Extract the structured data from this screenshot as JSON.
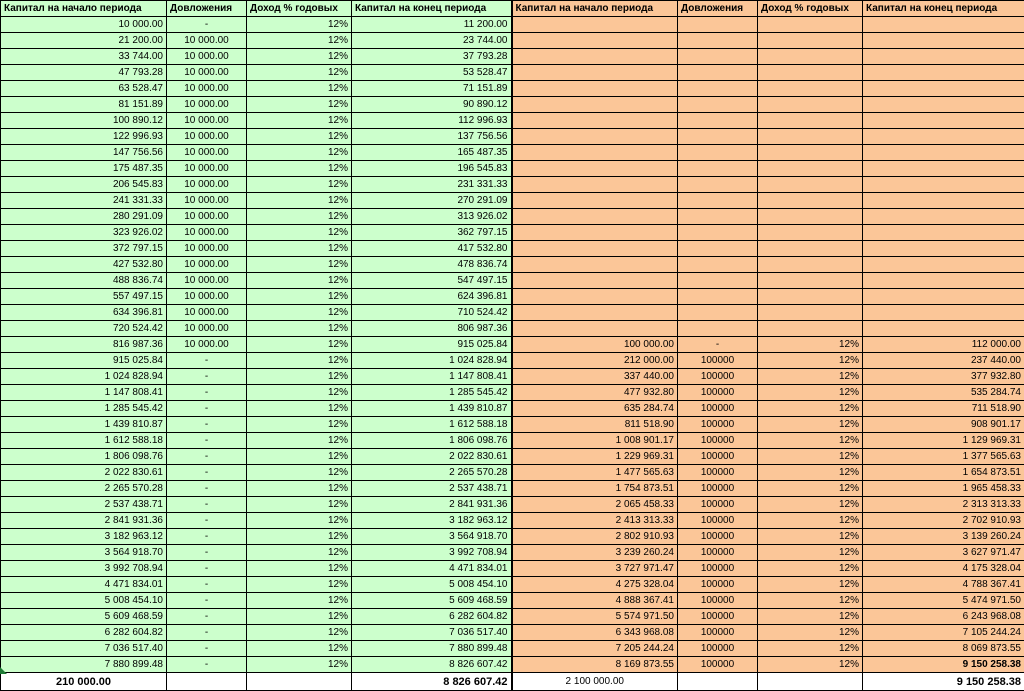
{
  "headers": {
    "left": [
      "Капитал на начало периода",
      "Довложения",
      "Доход % годовых",
      "Капитал на конец периода"
    ],
    "right": [
      "Капитал на начало периода",
      "Довложения",
      "Доход % годовых",
      "Капитал на конец периода"
    ]
  },
  "rows": [
    {
      "l": [
        "10 000.00",
        "-",
        "12%",
        "11 200.00"
      ],
      "r": [
        "",
        "",
        "",
        ""
      ]
    },
    {
      "l": [
        "21 200.00",
        "10 000.00",
        "12%",
        "23 744.00"
      ],
      "r": [
        "",
        "",
        "",
        ""
      ]
    },
    {
      "l": [
        "33 744.00",
        "10 000.00",
        "12%",
        "37 793.28"
      ],
      "r": [
        "",
        "",
        "",
        ""
      ]
    },
    {
      "l": [
        "47 793.28",
        "10 000.00",
        "12%",
        "53 528.47"
      ],
      "r": [
        "",
        "",
        "",
        ""
      ]
    },
    {
      "l": [
        "63 528.47",
        "10 000.00",
        "12%",
        "71 151.89"
      ],
      "r": [
        "",
        "",
        "",
        ""
      ]
    },
    {
      "l": [
        "81 151.89",
        "10 000.00",
        "12%",
        "90 890.12"
      ],
      "r": [
        "",
        "",
        "",
        ""
      ]
    },
    {
      "l": [
        "100 890.12",
        "10 000.00",
        "12%",
        "112 996.93"
      ],
      "r": [
        "",
        "",
        "",
        ""
      ]
    },
    {
      "l": [
        "122 996.93",
        "10 000.00",
        "12%",
        "137 756.56"
      ],
      "r": [
        "",
        "",
        "",
        ""
      ]
    },
    {
      "l": [
        "147 756.56",
        "10 000.00",
        "12%",
        "165 487.35"
      ],
      "r": [
        "",
        "",
        "",
        ""
      ]
    },
    {
      "l": [
        "175 487.35",
        "10 000.00",
        "12%",
        "196 545.83"
      ],
      "r": [
        "",
        "",
        "",
        ""
      ]
    },
    {
      "l": [
        "206 545.83",
        "10 000.00",
        "12%",
        "231 331.33"
      ],
      "r": [
        "",
        "",
        "",
        ""
      ]
    },
    {
      "l": [
        "241 331.33",
        "10 000.00",
        "12%",
        "270 291.09"
      ],
      "r": [
        "",
        "",
        "",
        ""
      ]
    },
    {
      "l": [
        "280 291.09",
        "10 000.00",
        "12%",
        "313 926.02"
      ],
      "r": [
        "",
        "",
        "",
        ""
      ]
    },
    {
      "l": [
        "323 926.02",
        "10 000.00",
        "12%",
        "362 797.15"
      ],
      "r": [
        "",
        "",
        "",
        ""
      ]
    },
    {
      "l": [
        "372 797.15",
        "10 000.00",
        "12%",
        "417 532.80"
      ],
      "r": [
        "",
        "",
        "",
        ""
      ]
    },
    {
      "l": [
        "427 532.80",
        "10 000.00",
        "12%",
        "478 836.74"
      ],
      "r": [
        "",
        "",
        "",
        ""
      ]
    },
    {
      "l": [
        "488 836.74",
        "10 000.00",
        "12%",
        "547 497.15"
      ],
      "r": [
        "",
        "",
        "",
        ""
      ]
    },
    {
      "l": [
        "557 497.15",
        "10 000.00",
        "12%",
        "624 396.81"
      ],
      "r": [
        "",
        "",
        "",
        ""
      ]
    },
    {
      "l": [
        "634 396.81",
        "10 000.00",
        "12%",
        "710 524.42"
      ],
      "r": [
        "",
        "",
        "",
        ""
      ]
    },
    {
      "l": [
        "720 524.42",
        "10 000.00",
        "12%",
        "806 987.36"
      ],
      "r": [
        "",
        "",
        "",
        ""
      ]
    },
    {
      "l": [
        "816 987.36",
        "10 000.00",
        "12%",
        "915 025.84"
      ],
      "r": [
        "100 000.00",
        "-",
        "12%",
        "112 000.00"
      ]
    },
    {
      "l": [
        "915 025.84",
        "-",
        "12%",
        "1 024 828.94"
      ],
      "r": [
        "212 000.00",
        "100000",
        "12%",
        "237 440.00"
      ]
    },
    {
      "l": [
        "1 024 828.94",
        "-",
        "12%",
        "1 147 808.41"
      ],
      "r": [
        "337 440.00",
        "100000",
        "12%",
        "377 932.80"
      ]
    },
    {
      "l": [
        "1 147 808.41",
        "-",
        "12%",
        "1 285 545.42"
      ],
      "r": [
        "477 932.80",
        "100000",
        "12%",
        "535 284.74"
      ]
    },
    {
      "l": [
        "1 285 545.42",
        "-",
        "12%",
        "1 439 810.87"
      ],
      "r": [
        "635 284.74",
        "100000",
        "12%",
        "711 518.90"
      ]
    },
    {
      "l": [
        "1 439 810.87",
        "-",
        "12%",
        "1 612 588.18"
      ],
      "r": [
        "811 518.90",
        "100000",
        "12%",
        "908 901.17"
      ]
    },
    {
      "l": [
        "1 612 588.18",
        "-",
        "12%",
        "1 806 098.76"
      ],
      "r": [
        "1 008 901.17",
        "100000",
        "12%",
        "1 129 969.31"
      ]
    },
    {
      "l": [
        "1 806 098.76",
        "-",
        "12%",
        "2 022 830.61"
      ],
      "r": [
        "1 229 969.31",
        "100000",
        "12%",
        "1 377 565.63"
      ]
    },
    {
      "l": [
        "2 022 830.61",
        "-",
        "12%",
        "2 265 570.28"
      ],
      "r": [
        "1 477 565.63",
        "100000",
        "12%",
        "1 654 873.51"
      ]
    },
    {
      "l": [
        "2 265 570.28",
        "-",
        "12%",
        "2 537 438.71"
      ],
      "r": [
        "1 754 873.51",
        "100000",
        "12%",
        "1 965 458.33"
      ]
    },
    {
      "l": [
        "2 537 438.71",
        "-",
        "12%",
        "2 841 931.36"
      ],
      "r": [
        "2 065 458.33",
        "100000",
        "12%",
        "2 313 313.33"
      ]
    },
    {
      "l": [
        "2 841 931.36",
        "-",
        "12%",
        "3 182 963.12"
      ],
      "r": [
        "2 413 313.33",
        "100000",
        "12%",
        "2 702 910.93"
      ]
    },
    {
      "l": [
        "3 182 963.12",
        "-",
        "12%",
        "3 564 918.70"
      ],
      "r": [
        "2 802 910.93",
        "100000",
        "12%",
        "3 139 260.24"
      ]
    },
    {
      "l": [
        "3 564 918.70",
        "-",
        "12%",
        "3 992 708.94"
      ],
      "r": [
        "3 239 260.24",
        "100000",
        "12%",
        "3 627 971.47"
      ]
    },
    {
      "l": [
        "3 992 708.94",
        "-",
        "12%",
        "4 471 834.01"
      ],
      "r": [
        "3 727 971.47",
        "100000",
        "12%",
        "4 175 328.04"
      ]
    },
    {
      "l": [
        "4 471 834.01",
        "-",
        "12%",
        "5 008 454.10"
      ],
      "r": [
        "4 275 328.04",
        "100000",
        "12%",
        "4 788 367.41"
      ]
    },
    {
      "l": [
        "5 008 454.10",
        "-",
        "12%",
        "5 609 468.59"
      ],
      "r": [
        "4 888 367.41",
        "100000",
        "12%",
        "5 474 971.50"
      ]
    },
    {
      "l": [
        "5 609 468.59",
        "-",
        "12%",
        "6 282 604.82"
      ],
      "r": [
        "5 574 971.50",
        "100000",
        "12%",
        "6 243 968.08"
      ]
    },
    {
      "l": [
        "6 282 604.82",
        "-",
        "12%",
        "7 036 517.40"
      ],
      "r": [
        "6 343 968.08",
        "100000",
        "12%",
        "7 105 244.24"
      ]
    },
    {
      "l": [
        "7 036 517.40",
        "-",
        "12%",
        "7 880 899.48"
      ],
      "r": [
        "7 205 244.24",
        "100000",
        "12%",
        "8 069 873.55"
      ]
    },
    {
      "l": [
        "7 880 899.48",
        "-",
        "12%",
        "8 826 607.42"
      ],
      "r": [
        "8 169 873.55",
        "100000",
        "12%",
        "9 150 258.38"
      ]
    }
  ],
  "totals": {
    "left_invested": "210 000.00",
    "left_final": "8 826 607.42",
    "right_invested": "2 100 000.00",
    "right_final": "9 150 258.38"
  },
  "colors": {
    "left_fill": "#ccffcc",
    "right_fill": "#fbc698",
    "corner_marker": "#1e7b34"
  }
}
